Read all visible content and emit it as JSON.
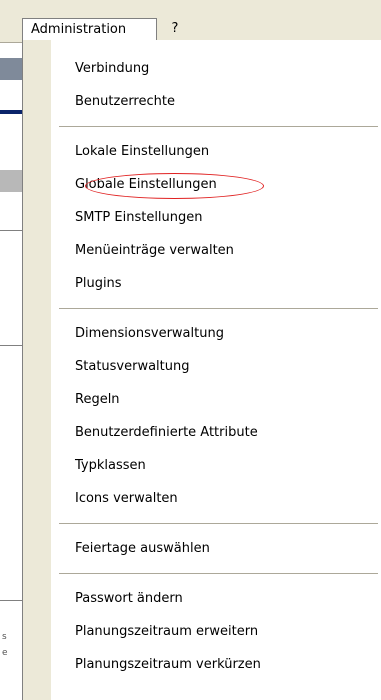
{
  "menubar": {
    "items": [
      {
        "label": "Administration",
        "active": true
      },
      {
        "label": "?",
        "active": false
      }
    ]
  },
  "menu": {
    "groups": [
      [
        "Verbindung",
        "Benutzerrechte"
      ],
      [
        "Lokale Einstellungen",
        "Globale Einstellungen",
        "SMTP Einstellungen",
        "Menüeinträge verwalten",
        "Plugins"
      ],
      [
        "Dimensionsverwaltung",
        "Statusverwaltung",
        "Regeln",
        "Benutzerdefinierte Attribute",
        "Typklassen",
        "Icons verwalten"
      ],
      [
        "Feiertage auswählen"
      ],
      [
        "Passwort ändern",
        "Planungszeitraum erweitern",
        "Planungszeitraum verkürzen"
      ]
    ],
    "highlighted_item": "Globale Einstellungen",
    "highlight_color": "#e02020"
  },
  "background": {
    "fragments": [
      "s",
      "e"
    ]
  }
}
